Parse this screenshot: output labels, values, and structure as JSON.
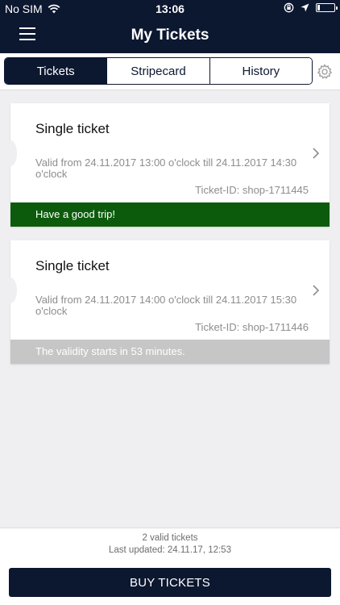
{
  "status_bar": {
    "carrier": "No SIM",
    "time": "13:06",
    "battery_level": 0.15
  },
  "nav": {
    "title": "My Tickets"
  },
  "tabs": [
    {
      "label": "Tickets",
      "active": true
    },
    {
      "label": "Stripecard",
      "active": false
    },
    {
      "label": "History",
      "active": false
    }
  ],
  "tickets": [
    {
      "title": "Single ticket",
      "validity": "Valid from 24.11.2017 13:00 o'clock till 24.11.2017 14:30 o'clock",
      "ticket_id": "Ticket-ID: shop-1711445",
      "status_text": "Have a good trip!",
      "status_color": "#0c5b0c"
    },
    {
      "title": "Single ticket",
      "validity": "Valid from 24.11.2017 14:00 o'clock till 24.11.2017 15:30 o'clock",
      "ticket_id": "Ticket-ID: shop-1711446",
      "status_text": "The validity starts in 53 minutes.",
      "status_color": "#c6c6c6"
    }
  ],
  "footer": {
    "valid_count": "2 valid tickets",
    "last_updated": "Last updated: 24.11.17, 12:53",
    "buy_label": "BUY TICKETS"
  },
  "colors": {
    "brand": "#0c1730",
    "background": "#efeef0",
    "active_green": "#0c5b0c",
    "pending_gray": "#c6c6c6"
  },
  "icons": [
    "wifi-icon",
    "orientation-lock-icon",
    "location-arrow-icon",
    "battery-icon",
    "menu-icon",
    "gear-icon",
    "chevron-right-icon"
  ]
}
